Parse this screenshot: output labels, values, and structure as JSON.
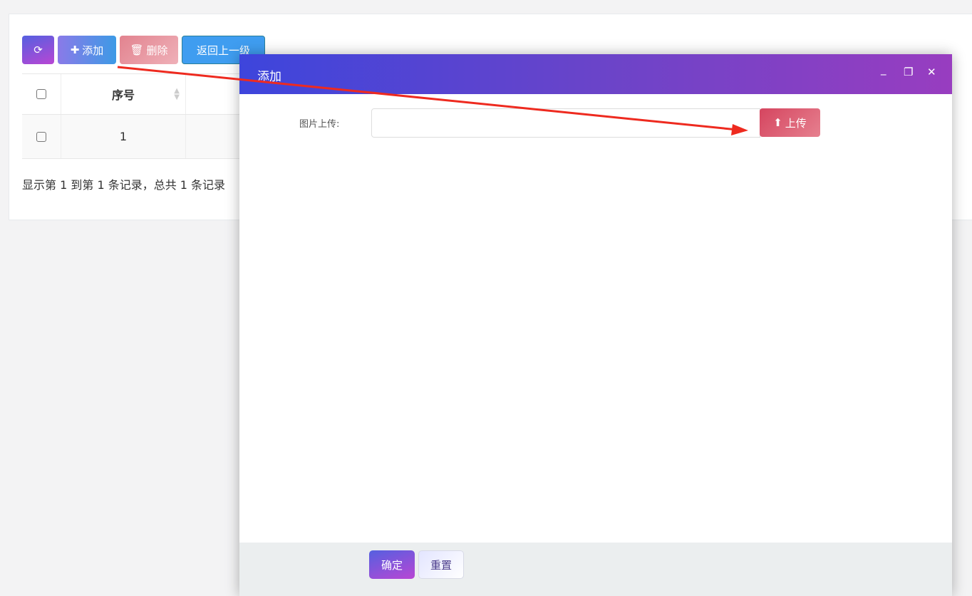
{
  "toolbar": {
    "refresh_icon": "refresh-icon",
    "add_label": "添加",
    "delete_label": "删除",
    "back_label": "返回上一级"
  },
  "table": {
    "columns": [
      "序号"
    ],
    "rows": [
      {
        "index": "1"
      }
    ]
  },
  "pagination": {
    "summary": "显示第 1 到第 1 条记录，总共 1 条记录"
  },
  "dialog": {
    "title": "添加",
    "field_label": "图片上传:",
    "field_value": "",
    "upload_label": "上传",
    "confirm_label": "确定",
    "reset_label": "重置"
  },
  "colors": {
    "dialog_header_start": "#3d45dc",
    "dialog_header_end": "#983dc0",
    "upload": "#d5455f",
    "annotation_arrow": "#ee2a1f"
  }
}
